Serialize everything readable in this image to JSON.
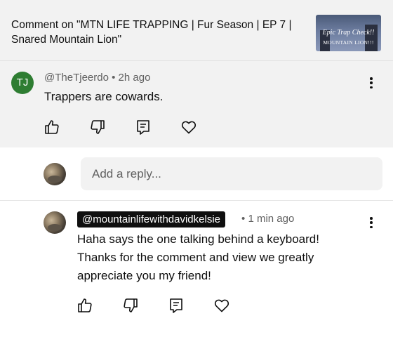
{
  "header": {
    "title_line1": "Comment on \"MTN LIFE TRAPPING | Fur Season | EP 7 |",
    "title_line2": "Snared Mountain Lion\"",
    "thumbnail": {
      "line1": "Epic Trap Check!!",
      "line2": "MOUNTAIN LION!!!"
    }
  },
  "comment": {
    "avatar_initials": "TJ",
    "avatar_color": "#2e7d32",
    "author": "@TheTjeerdo",
    "separator": "•",
    "time": "2h ago",
    "text": "Trappers are cowards.",
    "icons": [
      "like-icon",
      "dislike-icon",
      "reply-icon",
      "heart-icon",
      "more-vert-icon"
    ]
  },
  "reply_box": {
    "placeholder": "Add a reply..."
  },
  "reply": {
    "author": "@mountainlifewithdavidkelsie",
    "separator": "•",
    "time": "1 min ago",
    "text_lines": [
      "Haha says the one talking behind a keyboard!",
      "Thanks for the comment and view we greatly",
      "appreciate you my friend!"
    ],
    "icons": [
      "like-icon",
      "dislike-icon",
      "reply-icon",
      "heart-icon",
      "more-vert-icon"
    ]
  }
}
